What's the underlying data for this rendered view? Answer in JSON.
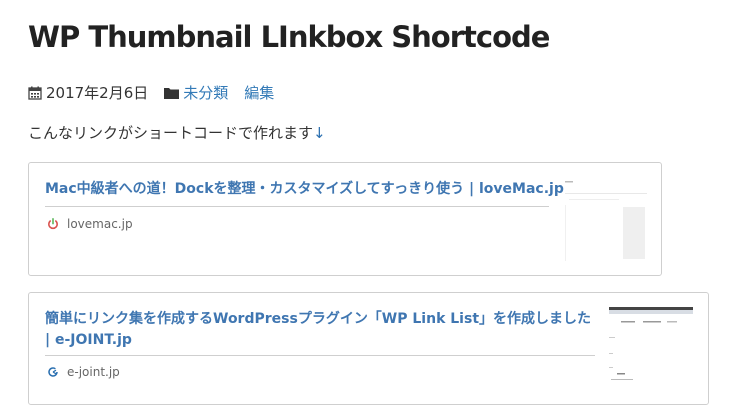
{
  "post": {
    "title": "WP Thumbnail LInkbox Shortcode",
    "date": "2017年2月6日",
    "category": "未分類",
    "edit": "編集",
    "intro": "こんなリンクがショートコードで作れます",
    "intro_arrow": "↓"
  },
  "linkboxes": [
    {
      "title": "Mac中級者への道！Dockを整理・カスタマイズしてすっきり使う | loveMac.jp",
      "site": "lovemac.jp",
      "favicon": "power-icon",
      "favicon_color": "#d9534f"
    },
    {
      "title": "簡単にリンク集を作成するWordPressプラグイン「WP Link List」を作成しました | e-JOINT.jp",
      "site": "e-joint.jp",
      "favicon": "e-logo-icon",
      "favicon_color": "#2a6fb0"
    }
  ],
  "colors": {
    "link": "#3f76b1",
    "text": "#333333",
    "border": "#cfcfcf"
  }
}
